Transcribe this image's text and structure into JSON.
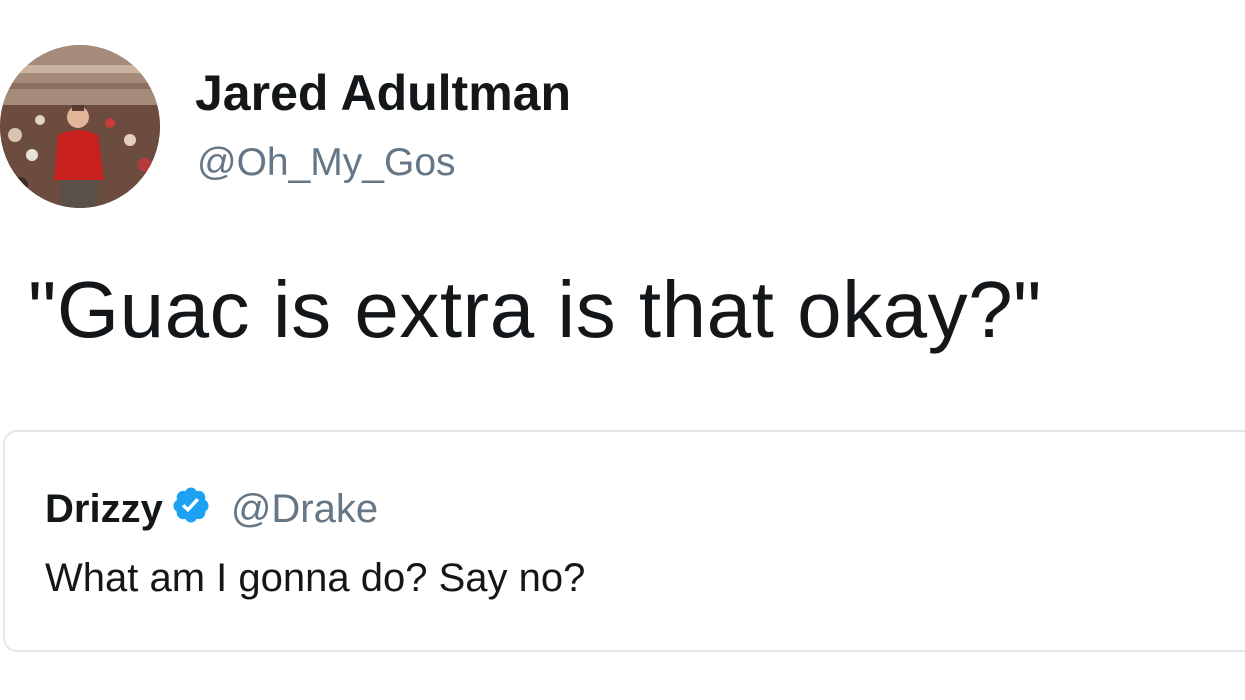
{
  "tweet": {
    "author": {
      "name": "Jared Adultman",
      "handle": "@Oh_My_Gos"
    },
    "text": "\"Guac is extra is that okay?\"",
    "quoted_tweet": {
      "author_name": "Drizzy",
      "author_handle": "@Drake",
      "verified": true,
      "verified_icon": "verified-badge-icon",
      "text": "What am I gonna do? Say no?"
    }
  },
  "colors": {
    "text_primary": "#14171a",
    "text_secondary": "#657786",
    "verified_blue": "#1da1f2",
    "card_border": "#e1e8ed"
  }
}
